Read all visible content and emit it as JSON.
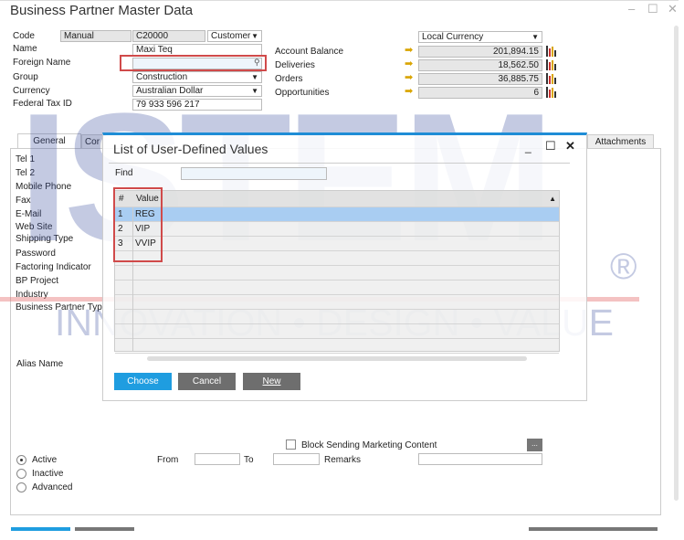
{
  "window": {
    "title": "Business Partner Master Data",
    "minimize": "–",
    "maximize": "☐",
    "close": "✕"
  },
  "header": {
    "code_label": "Code",
    "code_series": "Manual",
    "code_value": "C20000",
    "bp_type": "Customer",
    "name_label": "Name",
    "name_value": "Maxi Teq",
    "foreign_name_label": "Foreign Name",
    "foreign_name_value": "",
    "group_label": "Group",
    "group_value": "Construction",
    "currency_label": "Currency",
    "currency_value": "Australian Dollar",
    "tax_label": "Federal Tax ID",
    "tax_value": "79 933 596 217",
    "currency_mode": "Local Currency",
    "balances": [
      {
        "label": "Account Balance",
        "value": "201,894.15"
      },
      {
        "label": "Deliveries",
        "value": "18,562.50"
      },
      {
        "label": "Orders",
        "value": "36,885.75"
      },
      {
        "label": "Opportunities",
        "value": "6"
      }
    ]
  },
  "tabs": [
    {
      "label": "General"
    },
    {
      "label": "Cor"
    },
    {
      "label": "Attachments"
    }
  ],
  "general": {
    "fields": [
      "Tel 1",
      "Tel 2",
      "Mobile Phone",
      "Fax",
      "E-Mail",
      "Web Site",
      "Shipping Type",
      "Password",
      "Factoring Indicator",
      "BP Project",
      "Industry",
      "Business Partner Typ"
    ],
    "alias_label": "Alias Name",
    "block_marketing": "Block Sending Marketing Content",
    "more_button": "...",
    "status": [
      {
        "label": "Active",
        "selected": true
      },
      {
        "label": "Inactive",
        "selected": false
      },
      {
        "label": "Advanced",
        "selected": false
      }
    ],
    "from_label": "From",
    "to_label": "To",
    "remarks_label": "Remarks"
  },
  "dialog": {
    "title": "List of User-Defined Values",
    "find_label": "Find",
    "find_value": "",
    "columns": [
      "#",
      "Value"
    ],
    "rows": [
      {
        "n": "1",
        "value": "REG"
      },
      {
        "n": "2",
        "value": "VIP"
      },
      {
        "n": "3",
        "value": "VVIP"
      }
    ],
    "choose": "Choose",
    "cancel": "Cancel",
    "new": "New",
    "minimize": "_",
    "maximize": "☐",
    "close": "✕"
  },
  "watermark": {
    "logo": "ISTEM",
    "reg": "®",
    "tagline": "INNOVATION • DESIGN • VALUE"
  },
  "colors": {
    "accent": "#1f8dd6",
    "highlight": "#d04a4a",
    "selected_row": "#a9cdf2",
    "arrow": "#d9a400"
  }
}
